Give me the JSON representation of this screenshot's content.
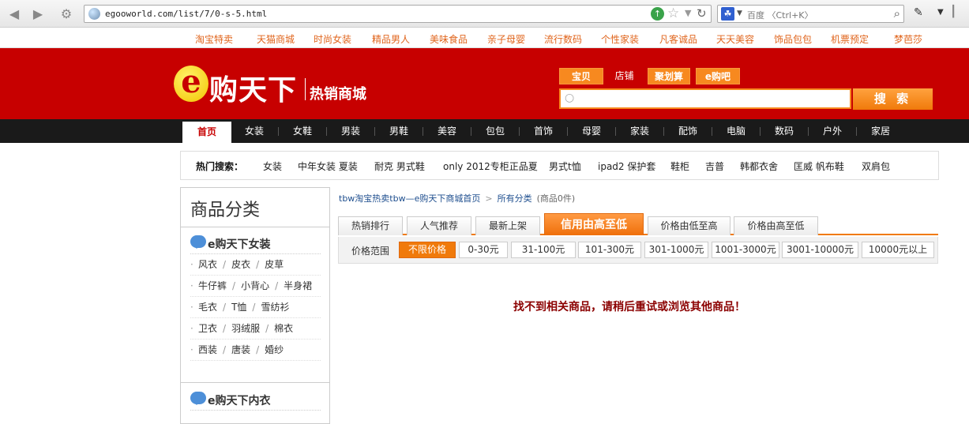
{
  "browser": {
    "url": "egooworld.com/list/7/0-s-5.html",
    "search_placeholder": "百度 〈Ctrl+K〉"
  },
  "top_links": [
    "淘宝特卖",
    "天猫商城",
    "时尚女装",
    "精品男人",
    "美味食品",
    "亲子母婴",
    "流行数码",
    "个性家装",
    "凡客诚品",
    "天天美容",
    "饰品包包",
    "机票预定",
    "梦芭莎"
  ],
  "logo": {
    "main": "购天下",
    "sub": "热销商城",
    "letter": "e"
  },
  "search_tabs": [
    "宝贝",
    "店铺",
    "聚划算",
    "e购吧"
  ],
  "search_button": "搜 索",
  "main_nav": [
    "首页",
    "女装",
    "女鞋",
    "男装",
    "男鞋",
    "美容",
    "包包",
    "首饰",
    "母婴",
    "家装",
    "配饰",
    "电脑",
    "数码",
    "户外",
    "家居"
  ],
  "hot_search": {
    "label": "热门搜索：",
    "items": [
      "女装",
      "中年女装 夏装",
      "耐克 男式鞋",
      "only 2012专柜正品夏",
      "男式t恤",
      "ipad2 保护套",
      "鞋柜",
      "吉普",
      "韩都衣舍",
      "匡威 帆布鞋",
      "双肩包"
    ]
  },
  "sidebar": {
    "title": "商品分类",
    "categories": [
      {
        "name": "e购天下女装",
        "rows": [
          [
            "风衣",
            "皮衣",
            "皮草"
          ],
          [
            "牛仔裤",
            "小背心",
            "半身裙"
          ],
          [
            "毛衣",
            "T恤",
            "雪纺衫"
          ],
          [
            "卫衣",
            "羽绒服",
            "棉衣"
          ],
          [
            "西装",
            "唐装",
            "婚纱"
          ]
        ]
      },
      {
        "name": "e购天下内衣",
        "rows": []
      }
    ]
  },
  "breadcrumb": {
    "home": "tbw淘宝热卖tbw—e购天下商城首页",
    "current": "所有分类",
    "count": "(商品0件)"
  },
  "sort_tabs": [
    "热销排行",
    "人气推荐",
    "最新上架",
    "信用由高至低",
    "价格由低至高",
    "价格由高至低"
  ],
  "price_filter": {
    "label": "价格范围",
    "options": [
      "不限价格",
      "0-30元",
      "31-100元",
      "101-300元",
      "301-1000元",
      "1001-3000元",
      "3001-10000元",
      "10000元以上"
    ]
  },
  "empty_message": "找不到相关商品，请稍后重试或浏览其他商品！"
}
